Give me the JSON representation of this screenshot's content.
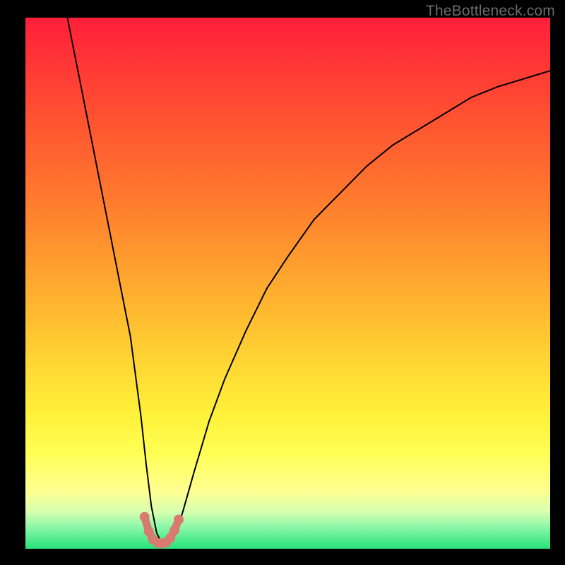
{
  "watermark": "TheBottleneck.com",
  "chart_data": {
    "type": "line",
    "title": "",
    "xlabel": "",
    "ylabel": "",
    "xlim": [
      0,
      100
    ],
    "ylim": [
      0,
      100
    ],
    "grid": false,
    "legend": false,
    "series": [
      {
        "name": "bottleneck-curve",
        "x": [
          8,
          10,
          12,
          14,
          16,
          18,
          20,
          22,
          23,
          24,
          25,
          26,
          27,
          28,
          29,
          30,
          32,
          35,
          38,
          42,
          46,
          50,
          55,
          60,
          65,
          70,
          75,
          80,
          85,
          90,
          95,
          100
        ],
        "y": [
          100,
          90,
          80,
          70,
          60,
          50,
          40,
          25,
          16,
          8,
          3,
          1,
          1,
          2,
          4,
          7,
          14,
          24,
          32,
          41,
          49,
          55,
          62,
          67,
          72,
          76,
          79,
          82,
          85,
          87,
          88.5,
          90
        ]
      }
    ],
    "markers": {
      "name": "trough-markers",
      "color": "#d87a6f",
      "points": [
        {
          "x": 22.7,
          "y": 6.0
        },
        {
          "x": 23.5,
          "y": 3.3
        },
        {
          "x": 24.3,
          "y": 1.8
        },
        {
          "x": 25.2,
          "y": 1.1
        },
        {
          "x": 26.0,
          "y": 1.0
        },
        {
          "x": 26.8,
          "y": 1.2
        },
        {
          "x": 27.6,
          "y": 2.0
        },
        {
          "x": 28.4,
          "y": 3.5
        },
        {
          "x": 29.2,
          "y": 5.5
        }
      ]
    },
    "background_gradient": {
      "top_color": "#ff1f3a",
      "bottom_color": "#25e37a"
    }
  }
}
